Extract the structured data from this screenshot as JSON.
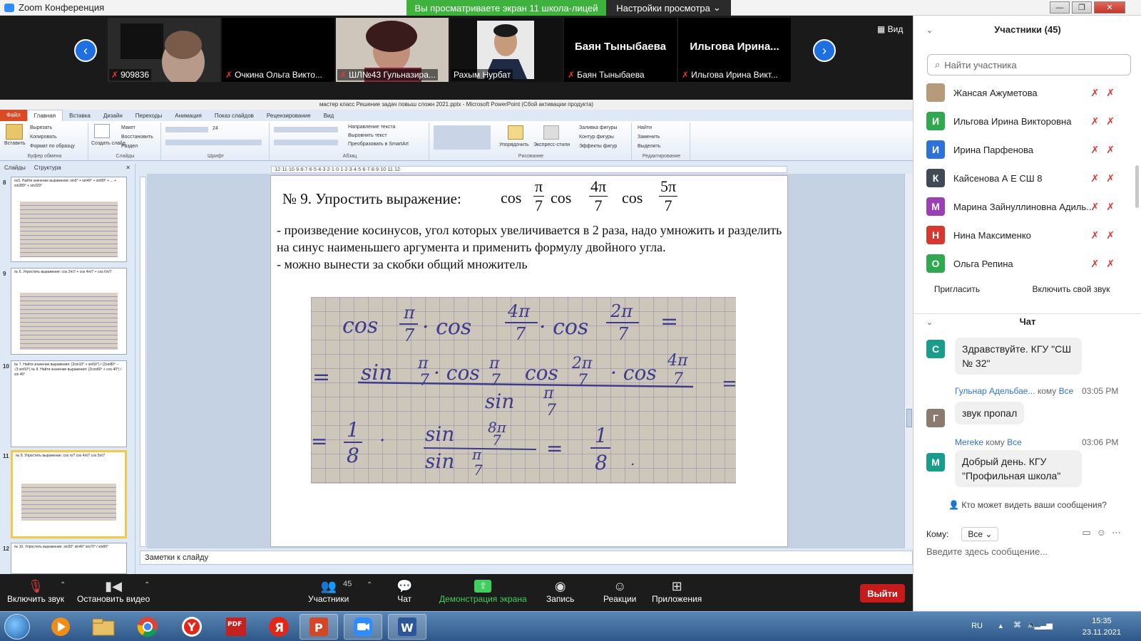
{
  "window": {
    "title": "Zoom Конференция",
    "share_banner": "Вы просматриваете экран 11 школа-лицей",
    "view_settings": "Настройки просмотра"
  },
  "strip": {
    "view_label": "Вид",
    "tiles": [
      {
        "name": "909836",
        "big": ""
      },
      {
        "name": "Очкина Ольга Викто...",
        "big": ""
      },
      {
        "name": "ШЛ№43 Гульназира...",
        "big": ""
      },
      {
        "name": "Рахым Нурбат",
        "big": ""
      },
      {
        "name": "Баян Тыныбаева",
        "big": "Баян Тыныбаева"
      },
      {
        "name": "Ильгова Ирина Викт...",
        "big": "Ильгова Ирина..."
      }
    ]
  },
  "ppt": {
    "title": "мастер класс Решение задач повыш сложн 2021.pptx - Microsoft PowerPoint (Сбой активации продукта)",
    "tabs": [
      "Файл",
      "Главная",
      "Вставка",
      "Дизайн",
      "Переходы",
      "Анимация",
      "Показ слайдов",
      "Рецензирование",
      "Вид"
    ],
    "ribbon": {
      "clipboard": {
        "label": "Буфер обмена",
        "paste": "Вставить",
        "cut": "Вырезать",
        "copy": "Копировать",
        "format": "Формат по образцу"
      },
      "slides": {
        "label": "Слайды",
        "create": "Создать слайд",
        "layout": "Макет",
        "restore": "Восстановить",
        "section": "Раздел"
      },
      "font": {
        "label": "Шрифт",
        "size": "24"
      },
      "paragraph": {
        "label": "Абзац",
        "text_dir": "Направление текста",
        "align_text": "Выровнять текст",
        "smartart": "Преобразовать в SmartArt"
      },
      "drawing": {
        "label": "Рисование",
        "arrange": "Упорядочить",
        "styles": "Экспресс-стили",
        "fill": "Заливка фигуры",
        "outline": "Контур фигуры",
        "effects": "Эффекты фигур"
      },
      "editing": {
        "label": "Редактирование",
        "find": "Найти",
        "replace": "Заменить",
        "select": "Выделить"
      }
    },
    "panel_tabs": [
      "Слайды",
      "Структура"
    ],
    "thumbs": [
      {
        "num": "8",
        "text": "№5. Найти значение выражения: sin9° + sin49° + sin89° + ... + sin289° + sin329°"
      },
      {
        "num": "9",
        "text": "№ 6. Упростить выражение: cos 2π/7 + cos 4π/7 + cos 6π/7"
      },
      {
        "num": "10",
        "text": "№ 7. Найти значение выражения: (2sin10° + sin50°) / (2sin80° − √3 sin50°)   № 8. Найти значение выражения: (2cos80° + cos 40°) / sin 40°"
      },
      {
        "num": "11",
        "text": "№ 9. Упростить выражение: cos π/7 cos 4π/7 cos 5π/7"
      },
      {
        "num": "12",
        "text": "№ 10. Упростить выражение: sin20° sin40° sin70° / sin80°"
      }
    ],
    "slide": {
      "problem": "№ 9. Упростить выражение:",
      "cos": "cos",
      "pi": "π",
      "four_pi": "4π",
      "five_pi": "5π",
      "seven": "7",
      "line1": "- произведение косинусов, угол которых увеличивается в 2 раза, надо умножить и разделить на синус наименьшего аргумента и применить формулу двойного угла.",
      "line2": "- можно вынести за скобки общий множитель",
      "board": {
        "r1": [
          "cos",
          "π",
          "7",
          "· cos",
          "4π",
          "7",
          "· cos",
          "2π",
          "7",
          "="
        ],
        "r2": [
          "=",
          "sin",
          "π",
          "7",
          "· cos",
          "π",
          "7",
          "cos",
          "2π",
          "7",
          "· cos",
          "4π",
          "7",
          "=",
          "sin",
          "π",
          "7"
        ],
        "r3": [
          "=",
          "1",
          "8",
          "·",
          "sin",
          "8π",
          "7",
          "sin",
          "π",
          "7",
          "=",
          "1",
          "8",
          "."
        ]
      }
    },
    "notes": "Заметки к слайду"
  },
  "toolbar": {
    "audio": "Включить звук",
    "video": "Остановить видео",
    "participants": "Участники",
    "participants_count": "45",
    "chat": "Чат",
    "share": "Демонстрация экрана",
    "record": "Запись",
    "reactions": "Реакции",
    "apps": "Приложения",
    "leave": "Выйти"
  },
  "participants_panel": {
    "title": "Участники (45)",
    "search_placeholder": "Найти участника",
    "list": [
      {
        "initial": "",
        "name": "Жансая Ажуметова",
        "color": "#b59b7a"
      },
      {
        "initial": "И",
        "name": "Ильгова Ирина Викторовна",
        "color": "#2fa84f"
      },
      {
        "initial": "И",
        "name": "Ирина Парфенова",
        "color": "#2d72d9"
      },
      {
        "initial": "К",
        "name": "Кайсенова А Е СШ 8",
        "color": "#3f4a55"
      },
      {
        "initial": "М",
        "name": "Марина Зайнуллиновна Адиль...",
        "color": "#9b3fb5"
      },
      {
        "initial": "Н",
        "name": "Нина Максименко",
        "color": "#d6372e"
      },
      {
        "initial": "О",
        "name": "Ольга Репина",
        "color": "#2fa84f"
      }
    ],
    "invite": "Пригласить",
    "unmute": "Включить свой звук"
  },
  "chat": {
    "title": "Чат",
    "messages": [
      {
        "initial": "С",
        "color": "#1a9c8a",
        "sender": "",
        "to": "",
        "recipient": "",
        "time": "",
        "text": "Здравствуйте. КГУ \"СШ № 32\""
      },
      {
        "initial": "Г",
        "color": "#8a7b6e",
        "sender": "Гульнар Адельбае...",
        "to": "кому",
        "recipient": "Все",
        "time": "03:05 PM",
        "text": "звук пропал"
      },
      {
        "initial": "M",
        "color": "#1a9c8a",
        "sender": "Mereke",
        "to": "кому",
        "recipient": "Все",
        "time": "03:06 PM",
        "text": "Добрый день. КГУ \"Профильная школа\""
      }
    ],
    "who_can_see": "Кто может видеть ваши сообщения?",
    "to_label": "Кому:",
    "to_value": "Все",
    "placeholder": "Введите здесь сообщение..."
  },
  "taskbar": {
    "lang": "RU",
    "time": "15:35",
    "date": "23.11.2021"
  }
}
